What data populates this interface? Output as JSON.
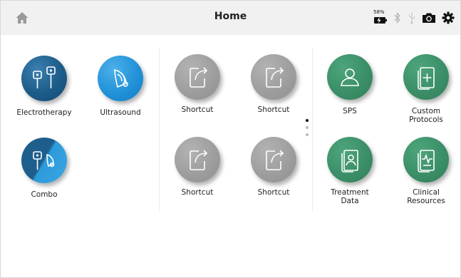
{
  "header": {
    "title": "Home"
  },
  "status": {
    "battery_percent": "58%"
  },
  "tiles": {
    "electrotherapy": "Electrotherapy",
    "ultrasound": "Ultrasound",
    "combo": "Combo",
    "shortcut_1": "Shortcut",
    "shortcut_2": "Shortcut",
    "shortcut_3": "Shortcut",
    "shortcut_4": "Shortcut",
    "sps": "SPS",
    "custom_protocols_1": "Custom",
    "custom_protocols_2": "Protocols",
    "treatment_data_1": "Treatment",
    "treatment_data_2": "Data",
    "clinical_resources_1": "Clinical",
    "clinical_resources_2": "Resources"
  },
  "icons": {
    "home": "home-icon",
    "bluetooth": "bluetooth-icon",
    "usb": "usb-icon",
    "camera": "camera-icon",
    "settings": "gear-icon"
  },
  "pager": {
    "pages": 3,
    "current": 1
  },
  "colors": {
    "electrotherapy": "#1c5c89",
    "ultrasound": "#1f8fd6",
    "shortcut": "#9c9c9c",
    "green": "#3a8d66",
    "topbar": "#f1f1f1"
  }
}
